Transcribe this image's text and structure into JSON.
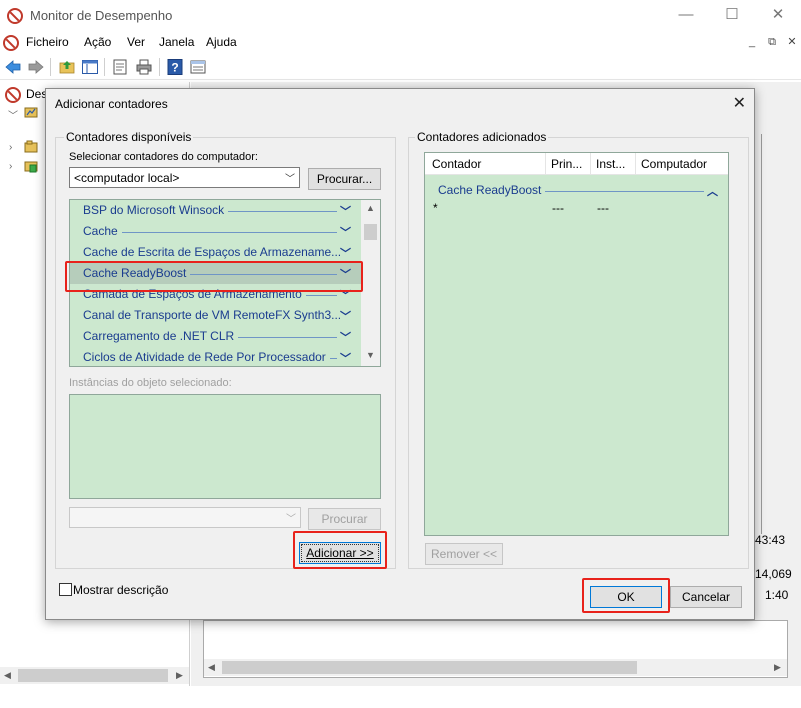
{
  "window": {
    "title": "Monitor de Desempenho",
    "minimize": "—",
    "maximize": "☐",
    "close": "✕"
  },
  "menu": [
    "Ficheiro",
    "Ação",
    "Ver",
    "Janela",
    "Ajuda"
  ],
  "left_pane": {
    "root_label": "Des"
  },
  "right_pane": {
    "time_value": "43:43",
    "value_1": "14,069",
    "value_2": "1:40"
  },
  "dialog": {
    "title": "Adicionar contadores",
    "close": "✕",
    "available_group": "Contadores disponíveis",
    "select_from_label": "Selecionar contadores do computador:",
    "computer_value": "<computador local>",
    "browse_button": "Procurar...",
    "counter_categories": [
      "BSP do Microsoft Winsock",
      "Cache",
      "Cache de Escrita de Espaços de Armazename...",
      "Cache ReadyBoost",
      "Camada de Espaços de Armazenamento",
      "Canal de Transporte de VM RemoteFX Synth3...",
      "Carregamento de .NET CLR",
      "Ciclos de Atividade de Rede Por Processador"
    ],
    "selected_index": 3,
    "instances_label": "Instâncias do objeto selecionado:",
    "search_button": "Procurar",
    "add_button": "Adicionar >>",
    "added_group": "Contadores adicionados",
    "columns": [
      "Contador",
      "Prin...",
      "Inst...",
      "Computador"
    ],
    "added_group_row": "Cache ReadyBoost",
    "added_row": {
      "counter": "*",
      "parent": "---",
      "instance": "---",
      "computer": ""
    },
    "remove_button": "Remover <<",
    "show_description": "Mostrar descrição",
    "ok_button": "OK",
    "cancel_button": "Cancelar"
  },
  "colors": {
    "list_background": "#cce8cf",
    "list_selected": "#b6cdbb",
    "list_text": "#1a3c8f",
    "highlight": "#e8221b"
  }
}
